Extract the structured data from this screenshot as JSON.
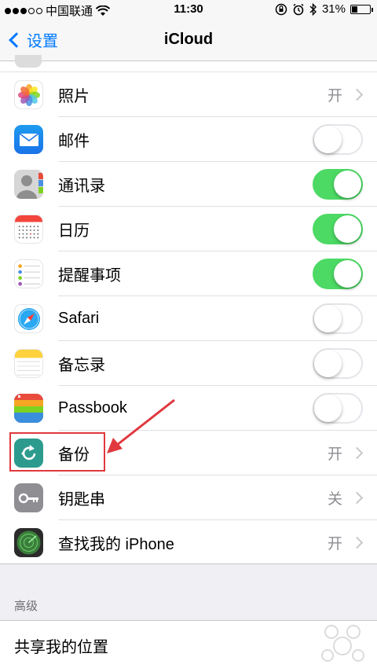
{
  "status": {
    "carrier": "中国联通",
    "time": "11:30",
    "battery": "31%",
    "battery_level": 0.31
  },
  "nav": {
    "back_label": "设置",
    "title": "iCloud"
  },
  "rows": [
    {
      "label": "照片",
      "value": "开",
      "kind": "detail",
      "icon": "photos-icon"
    },
    {
      "label": "邮件",
      "kind": "toggle",
      "on": false,
      "icon": "mail-icon"
    },
    {
      "label": "通讯录",
      "kind": "toggle",
      "on": true,
      "icon": "contacts-icon"
    },
    {
      "label": "日历",
      "kind": "toggle",
      "on": true,
      "icon": "calendar-icon"
    },
    {
      "label": "提醒事项",
      "kind": "toggle",
      "on": true,
      "icon": "reminders-icon"
    },
    {
      "label": "Safari",
      "kind": "toggle",
      "on": false,
      "icon": "safari-icon"
    },
    {
      "label": "备忘录",
      "kind": "toggle",
      "on": false,
      "icon": "notes-icon"
    },
    {
      "label": "Passbook",
      "kind": "toggle",
      "on": false,
      "icon": "passbook-icon"
    },
    {
      "label": "备份",
      "value": "开",
      "kind": "detail",
      "icon": "backup-icon"
    },
    {
      "label": "钥匙串",
      "value": "关",
      "kind": "detail",
      "icon": "keychain-icon"
    },
    {
      "label": "查找我的 iPhone",
      "value": "开",
      "kind": "detail",
      "icon": "find-my-iphone-icon"
    }
  ],
  "section": {
    "header": "高级",
    "share_location_label": "共享我的位置"
  },
  "colors": {
    "accent": "#007aff",
    "toggle_on": "#4cd964",
    "annotation": "#e0383e"
  }
}
